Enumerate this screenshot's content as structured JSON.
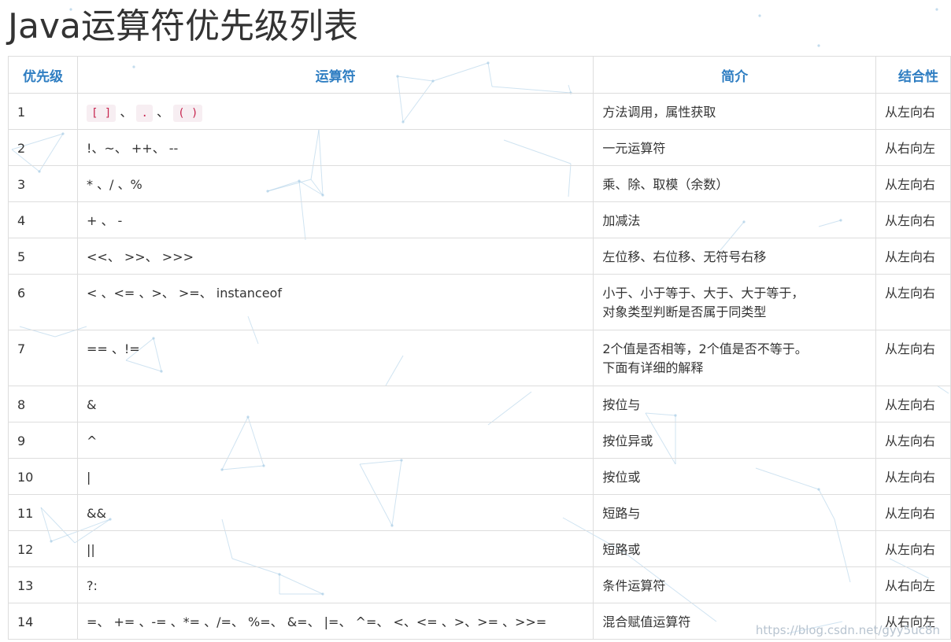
{
  "page": {
    "title": "Java运算符优先级列表",
    "watermark": "https://blog.csdn.net/gyy5uc8n"
  },
  "table": {
    "headers": {
      "priority": "优先级",
      "operator": "运算符",
      "description": "简介",
      "associativity": "结合性"
    },
    "row1_code": {
      "parts": [
        "[ ]",
        "、",
        ".",
        "、",
        "( )"
      ]
    },
    "rows": [
      {
        "priority": "1",
        "operator": "",
        "description": "方法调用，属性获取",
        "associativity": "从左向右"
      },
      {
        "priority": "2",
        "operator": "!、~、 ++、 --",
        "description": "一元运算符",
        "associativity": "从右向左"
      },
      {
        "priority": "3",
        "operator": "* 、/ 、%",
        "description": "乘、除、取模（余数）",
        "associativity": "从左向右"
      },
      {
        "priority": "4",
        "operator": "+ 、 -",
        "description": "加减法",
        "associativity": "从左向右"
      },
      {
        "priority": "5",
        "operator": "<<、 >>、 >>>",
        "description": "左位移、右位移、无符号右移",
        "associativity": "从左向右"
      },
      {
        "priority": "6",
        "operator": "< 、<= 、>、 >=、 instanceof",
        "description_line1": "小于、小于等于、大于、大于等于，",
        "description_line2": "对象类型判断是否属于同类型",
        "associativity": "从左向右"
      },
      {
        "priority": "7",
        "operator": "== 、!=",
        "description_line1": "2个值是否相等，2个值是否不等于。",
        "description_line2": "下面有详细的解释",
        "associativity": "从左向右"
      },
      {
        "priority": "8",
        "operator": "&",
        "description": "按位与",
        "associativity": "从左向右"
      },
      {
        "priority": "9",
        "operator": "^",
        "description": "按位异或",
        "associativity": "从左向右"
      },
      {
        "priority": "10",
        "operator": "|",
        "description": "按位或",
        "associativity": "从左向右"
      },
      {
        "priority": "11",
        "operator": "&&",
        "description": "短路与",
        "associativity": "从左向右"
      },
      {
        "priority": "12",
        "operator": "||",
        "description": "短路或",
        "associativity": "从左向右"
      },
      {
        "priority": "13",
        "operator": "?:",
        "description": "条件运算符",
        "associativity": "从右向左"
      },
      {
        "priority": "14",
        "operator": "=、 += 、-= 、*= 、/=、 %=、 &=、 |=、 ^=、 <、<= 、>、>= 、>>=",
        "description": "混合赋值运算符",
        "associativity": "从右向左"
      }
    ]
  },
  "colors": {
    "header_text": "#2f7ec2",
    "code_text": "#c7254e",
    "code_background": "#f7eef2",
    "border": "#dddddd",
    "background_lines": "#a9cde6"
  }
}
